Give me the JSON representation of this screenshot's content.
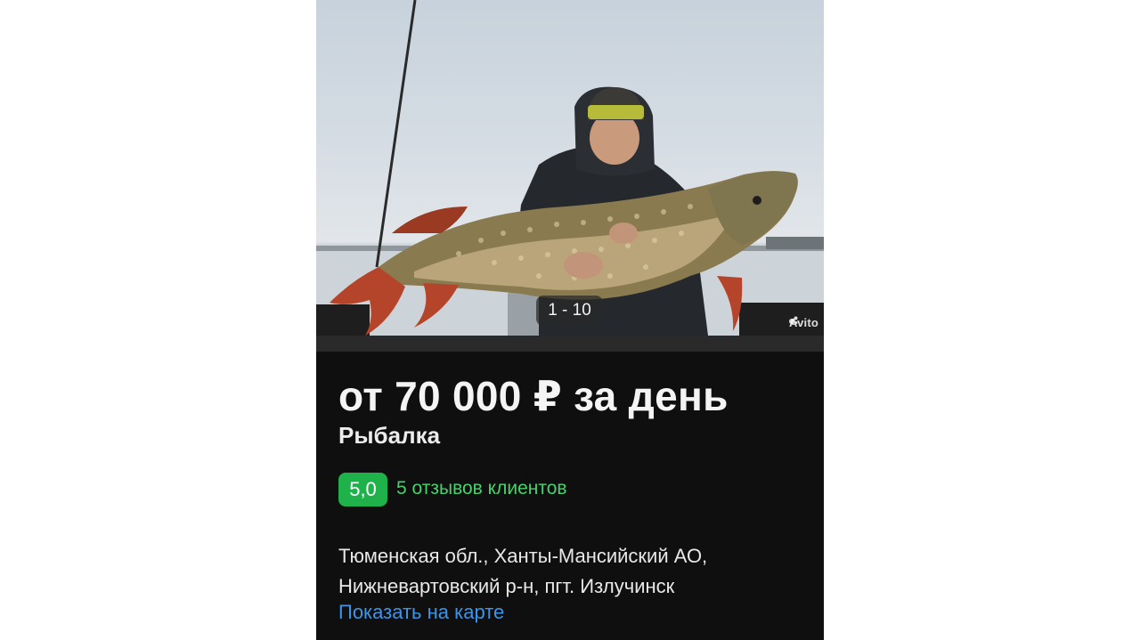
{
  "gallery": {
    "counter": "1 - 10",
    "watermark": "Avito",
    "photo_subject": "pike-fish-photo"
  },
  "listing": {
    "price": "от 70 000 ₽ за день",
    "category": "Рыбалка",
    "rating": "5,0",
    "reviews": "5 отзывов клиентов",
    "address_line1": "Тюменская обл., Ханты-Мансийский АО,",
    "address_line2": "Нижневартовский р-н, пгт. Излучинск",
    "map_link": "Показать на карте"
  },
  "colors": {
    "background": "#0f0f0f",
    "rating_badge": "#1fb24a",
    "reviews_text": "#44d36a",
    "link": "#3c95e8"
  }
}
